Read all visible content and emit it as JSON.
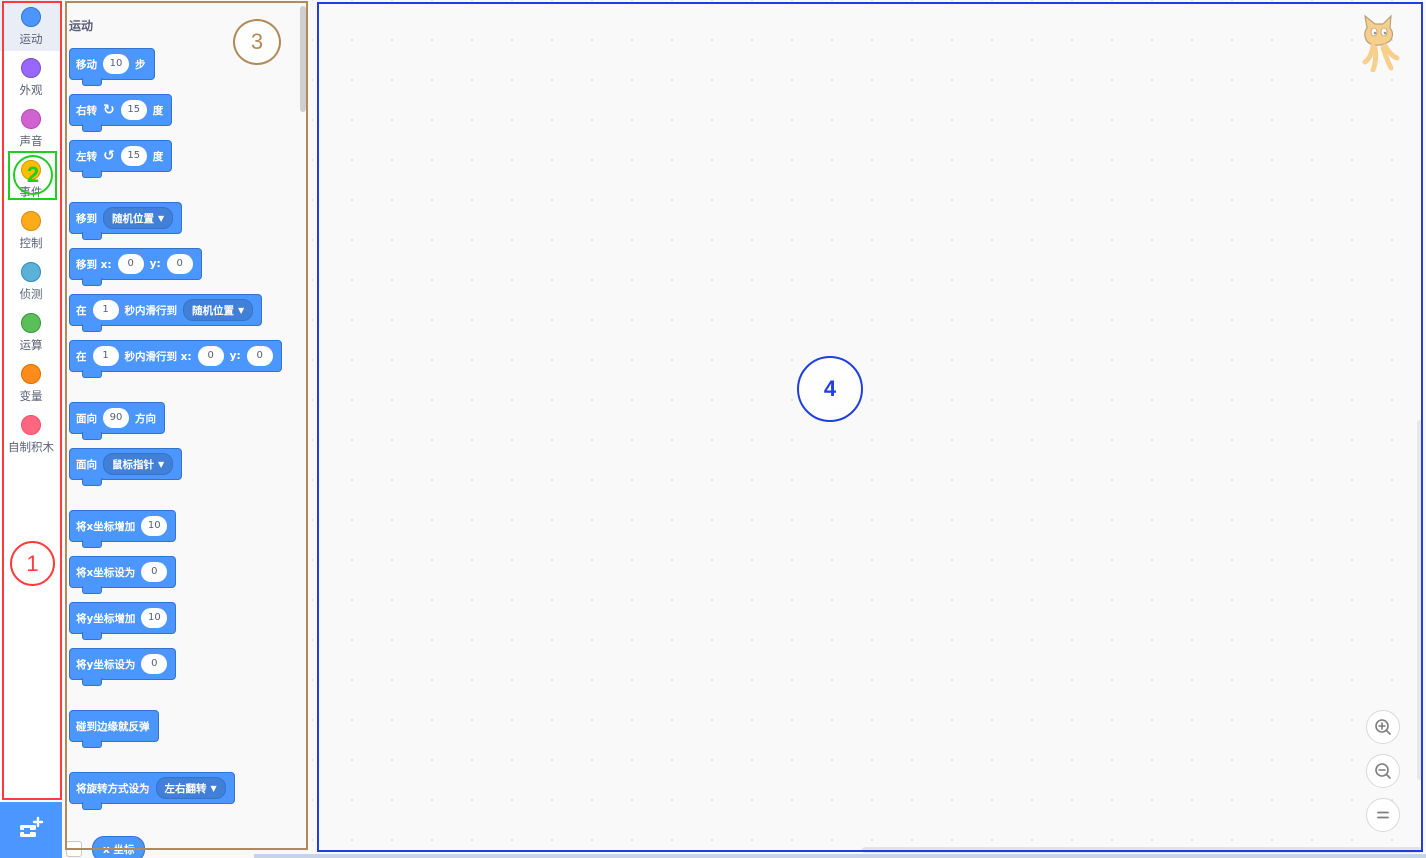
{
  "categories": [
    {
      "label": "运动",
      "color": "#4c97ff",
      "selected": true
    },
    {
      "label": "外观",
      "color": "#9966ff"
    },
    {
      "label": "声音",
      "color": "#cf63cf"
    },
    {
      "label": "事件",
      "color": "#ffbf00"
    },
    {
      "label": "控制",
      "color": "#ffab19"
    },
    {
      "label": "侦测",
      "color": "#5cb1d6"
    },
    {
      "label": "运算",
      "color": "#59c059"
    },
    {
      "label": "变量",
      "color": "#ff8c1a"
    },
    {
      "label": "自制积木",
      "color": "#ff6680"
    }
  ],
  "extension_button": {
    "icon": "add-extension-icon"
  },
  "flyout": {
    "title": "运动",
    "blocks": {
      "move": {
        "label": "移动",
        "value": "10",
        "unit": "步"
      },
      "turn_right": {
        "label": "右转",
        "icon": "rotate-clockwise-icon",
        "value": "15",
        "unit": "度"
      },
      "turn_left": {
        "label": "左转",
        "icon": "rotate-counterclockwise-icon",
        "value": "15",
        "unit": "度"
      },
      "goto": {
        "label": "移到",
        "dropdown": "随机位置"
      },
      "goto_xy": {
        "label": "移到 x:",
        "x": "0",
        "ylabel": "y:",
        "y": "0"
      },
      "glide": {
        "prefix": "在",
        "secs": "1",
        "label": "秒内滑行到",
        "dropdown": "随机位置"
      },
      "glide_xy": {
        "prefix": "在",
        "secs": "1",
        "label": "秒内滑行到 x:",
        "x": "0",
        "ylabel": "y:",
        "y": "0"
      },
      "point_dir": {
        "prefix": "面向",
        "value": "90",
        "unit": "方向"
      },
      "point_towards": {
        "label": "面向",
        "dropdown": "鼠标指针"
      },
      "change_x": {
        "label": "将x坐标增加",
        "value": "10"
      },
      "set_x": {
        "label": "将x坐标设为",
        "value": "0"
      },
      "change_y": {
        "label": "将y坐标增加",
        "value": "10"
      },
      "set_y": {
        "label": "将y坐标设为",
        "value": "0"
      },
      "bounce": {
        "label": "碰到边缘就反弹"
      },
      "rotation_style": {
        "label": "将旋转方式设为",
        "dropdown": "左右翻转"
      },
      "x_reporter": {
        "label": "x 坐标"
      }
    }
  },
  "workspace": {
    "sprite_icon": "cat-sprite-icon",
    "zoom_in_icon": "zoom-in-icon",
    "zoom_out_icon": "zoom-out-icon",
    "zoom_reset_icon": "zoom-reset-icon"
  },
  "annotations": [
    {
      "number": "1",
      "color": "#ff3b3b"
    },
    {
      "number": "2",
      "color": "#22cc22"
    },
    {
      "number": "3",
      "color": "#b08a5a"
    },
    {
      "number": "4",
      "color": "#1f3fe0"
    }
  ]
}
